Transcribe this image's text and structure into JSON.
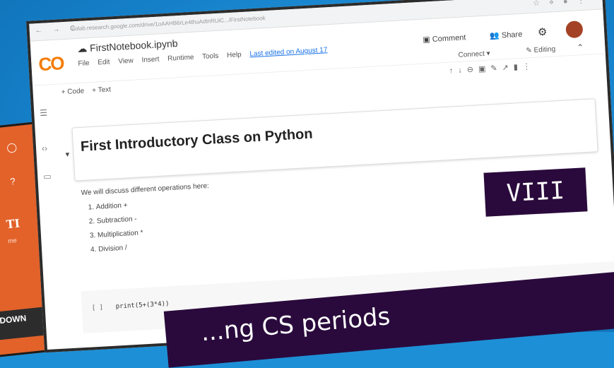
{
  "browser": {
    "url": "colab.research.google.com/drive/1oAAHB6rLe4thuAdtnRUiC.../FirstNotebook",
    "nav_icons": "← → C"
  },
  "notebook": {
    "logo": "CO",
    "filename": "FirstNotebook.ipynb",
    "menu": [
      "File",
      "Edit",
      "View",
      "Insert",
      "Runtime",
      "Tools",
      "Help"
    ],
    "last_edited": "Last edited on August 17",
    "comment_label": "Comment",
    "share_label": "Share",
    "connect_label": "Connect",
    "editing_label": "Editing",
    "add_code": "+ Code",
    "add_text": "+ Text"
  },
  "cells": {
    "heading": "First Introductory Class on Python",
    "intro": "We will discuss different operations here:",
    "items": [
      "Addition +",
      "Subtraction -",
      "Multiplication *",
      "Division /"
    ],
    "code_bracket": "[ ]",
    "code": "print(5+(3*4))"
  },
  "overlay": {
    "grade": "VIII",
    "banner": "...ng CS periods"
  },
  "left_card": {
    "ti_text": "TI",
    "down_text": "DOWN"
  },
  "colors": {
    "background": "#1d8fd6",
    "overlay_bg": "#2a0a3c",
    "orange_card": "#e2622a",
    "colab_yellow": "#f9ab00"
  }
}
